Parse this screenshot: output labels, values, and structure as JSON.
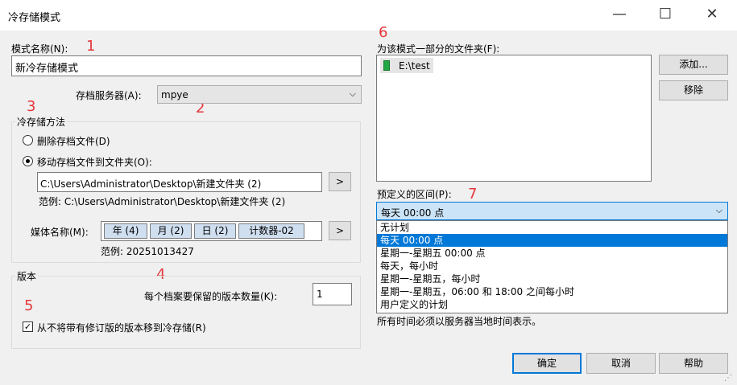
{
  "window": {
    "title": "冷存储模式",
    "minimize": "—",
    "maximize": "☐",
    "close": "✕"
  },
  "markers": [
    "1",
    "2",
    "3",
    "4",
    "5",
    "6",
    "7"
  ],
  "mode_name": {
    "label": "模式名称(N):",
    "value": "新冷存储模式"
  },
  "archive_server": {
    "label": "存档服务器(A):",
    "value": "mpye"
  },
  "method": {
    "group_label": "冷存储方法",
    "delete_label": "删除存档文件(D)",
    "move_label": "移动存档文件到文件夹(O):",
    "folder_value": "C:\\Users\\Administrator\\Desktop\\新建文件夹 (2)",
    "browse_label": ">",
    "folder_example": "范例: C:\\Users\\Administrator\\Desktop\\新建文件夹 (2)",
    "media_label": "媒体名称(M):",
    "media_tokens": [
      "年 (4)",
      "月 (2)",
      "日 (2)",
      "计数器-02"
    ],
    "media_button": ">",
    "media_example": "范例: 20251013427"
  },
  "version": {
    "group_label": "版本",
    "keep_label": "每个档案要保留的版本数量(K):",
    "keep_value": "1",
    "never_move_label": "从不将带有修订版的版本移到冷存储(R)"
  },
  "folders": {
    "label": "为该模式一部分的文件夹(F):",
    "items": [
      "E:\\test"
    ],
    "add_button": "添加...",
    "remove_button": "移除"
  },
  "schedule": {
    "label": "预定义的区间(P):",
    "selected": "每天 00:00 点",
    "options": [
      "无计划",
      "每天 00:00 点",
      "星期一-星期五 00:00 点",
      "每天，每小时",
      "星期一-星期五，每小时",
      "星期一-星期五，06:00 和 18:00 之间每小时",
      "用户定义的计划"
    ],
    "selected_index": 1,
    "note": "所有时间必须以服务器当地时间表示。"
  },
  "buttons": {
    "ok": "确定",
    "cancel": "取消",
    "help": "帮助"
  },
  "colors": {
    "selection": "#0078d7",
    "marker": "#e5383b",
    "folder_icon": "#22a745"
  }
}
